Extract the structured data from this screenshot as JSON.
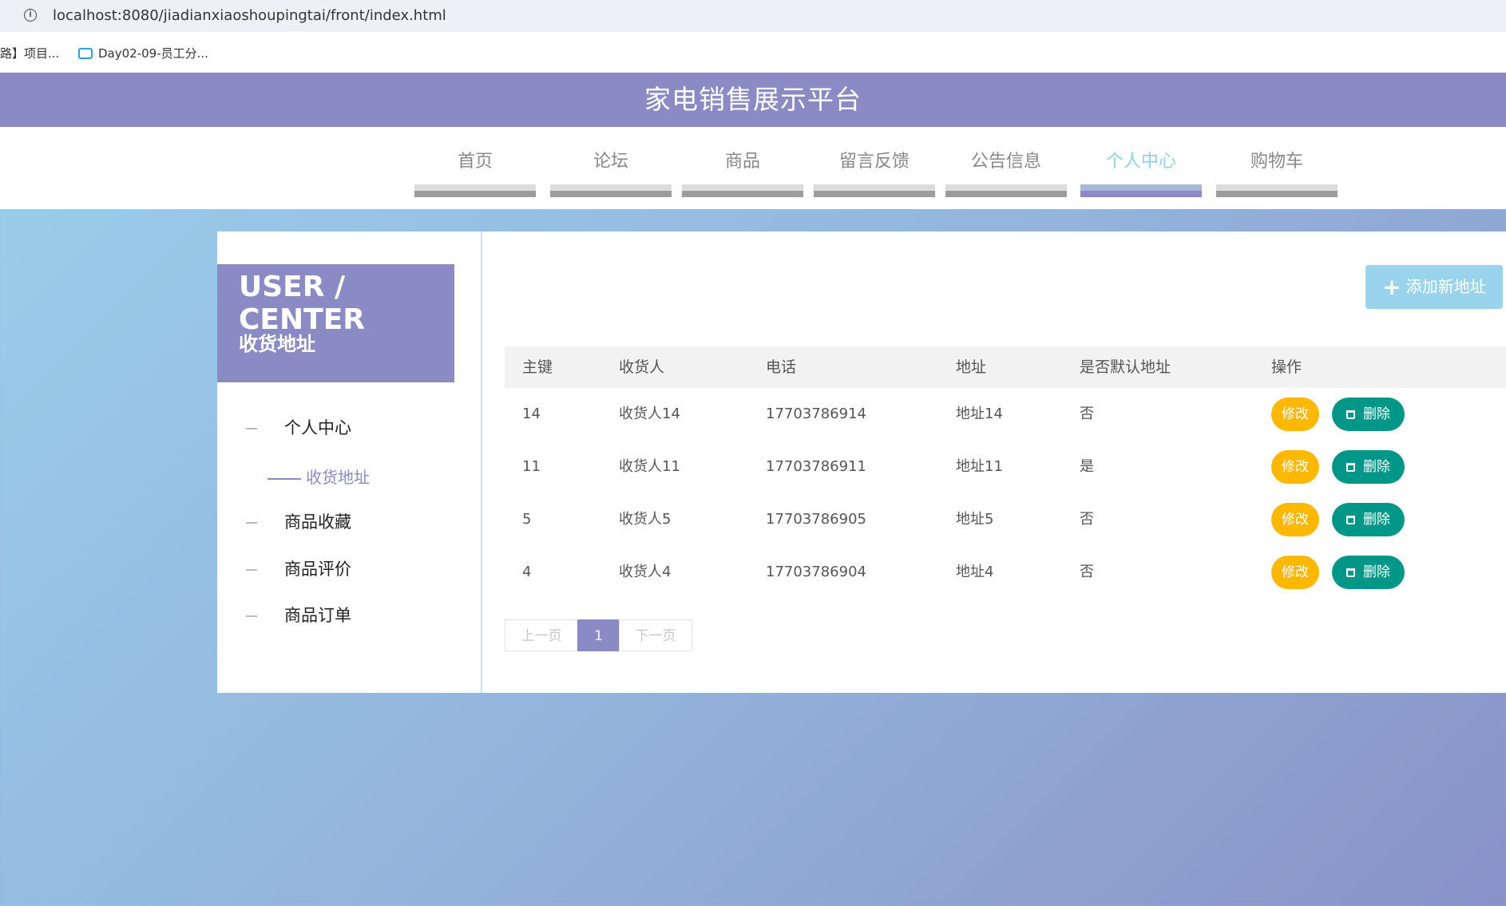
{
  "browser": {
    "url": "localhost:8080/jiadianxiaoshoupingtai/front/index.html",
    "bookmarks": [
      "路】项目...",
      "Day02-09-员工分..."
    ]
  },
  "site": {
    "title": "家电销售展示平台",
    "nav": [
      "首页",
      "论坛",
      "商品",
      "留言反馈",
      "公告信息",
      "个人中心",
      "购物车"
    ],
    "active_nav": "个人中心"
  },
  "sidebar": {
    "title": "USER / CENTER",
    "subtitle": "收货地址",
    "items": [
      "个人中心",
      "商品收藏",
      "商品评价",
      "商品订单"
    ],
    "active_sub": "收货地址"
  },
  "main": {
    "add_label": "添加新地址",
    "columns": [
      "主键",
      "收货人",
      "电话",
      "地址",
      "是否默认地址",
      "操作"
    ],
    "rows": [
      [
        "14",
        "收货人14",
        "17703786914",
        "地址14",
        "否"
      ],
      [
        "11",
        "收货人11",
        "17703786911",
        "地址11",
        "是"
      ],
      [
        "5",
        "收货人5",
        "17703786905",
        "地址5",
        "否"
      ],
      [
        "4",
        "收货人4",
        "17703786904",
        "地址4",
        "否"
      ]
    ],
    "edit_label": "修改",
    "delete_label": "删除",
    "pager": {
      "prev": "上一页",
      "current": "1",
      "next": "下一页"
    }
  },
  "colors": {
    "brand": "#8a8bc4",
    "accent": "#9ad3ec",
    "edit": "#ffb800",
    "delete": "#009688"
  }
}
